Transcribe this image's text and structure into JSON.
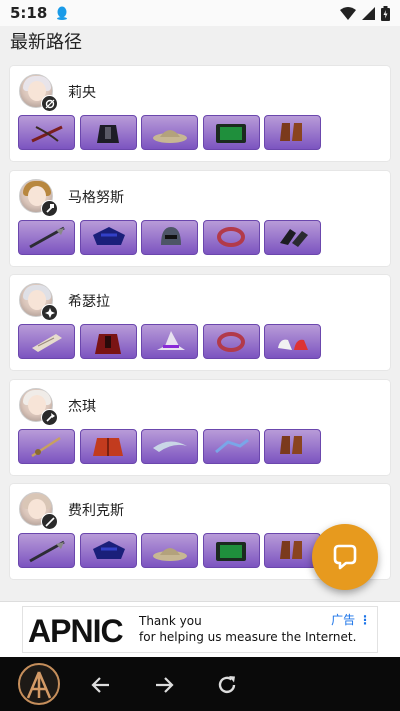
{
  "status_bar": {
    "time": "5:18"
  },
  "page_title": "最新路径",
  "paths": [
    {
      "name": "莉央",
      "weapon_icon": "bow-icon",
      "hair": "#e8e4ea",
      "items": [
        "crossbow-icon",
        "armor-icon",
        "hat-icon",
        "tablet-icon",
        "boots-icon"
      ]
    },
    {
      "name": "马格努斯",
      "weapon_icon": "hammer-icon",
      "hair": "#b8873f",
      "items": [
        "spear-icon",
        "chest-armor-icon",
        "helmet-icon",
        "bracelet-icon",
        "gloves-icon"
      ]
    },
    {
      "name": "希瑟拉",
      "weapon_icon": "shuriken-icon",
      "hair": "#dfe0e6",
      "items": [
        "scroll-icon",
        "robe-icon",
        "witch-hat-icon",
        "bracelet-icon",
        "sneakers-icon"
      ]
    },
    {
      "name": "杰琪",
      "weapon_icon": "axe-icon",
      "hair": "#f0ece8",
      "items": [
        "sword-icon",
        "jacket-icon",
        "blade-icon",
        "claw-icon",
        "boots-icon"
      ]
    },
    {
      "name": "费利克斯",
      "weapon_icon": "spear-icon",
      "hair": "#d9c6b6",
      "items": [
        "spear-icon",
        "chest-armor-icon",
        "hat-icon",
        "tablet-icon",
        "boots-icon"
      ]
    }
  ],
  "fab": {
    "icon": "chat-bubble-icon"
  },
  "ad": {
    "logo_text": "APNIC",
    "line1": "Thank you",
    "line2": "for helping us measure the Internet.",
    "label": "广告"
  },
  "nav": {
    "back_icon": "arrow-left-icon",
    "forward_icon": "arrow-right-icon",
    "reload_icon": "reload-icon"
  }
}
